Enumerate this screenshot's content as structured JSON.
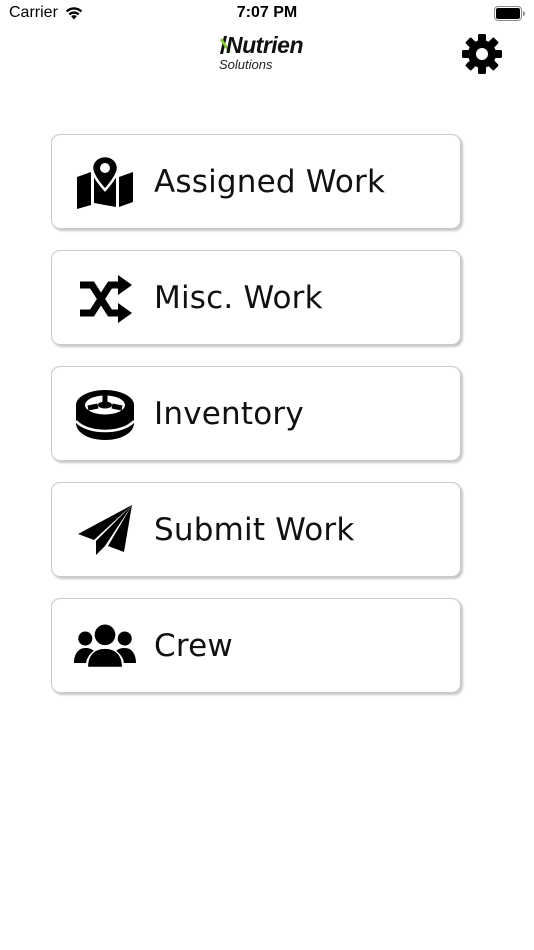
{
  "status_bar": {
    "carrier": "Carrier",
    "time": "7:07 PM",
    "wifi_icon": "wifi-icon",
    "battery_icon": "battery-icon"
  },
  "header": {
    "logo_word": "Nutrien",
    "logo_sub": "Solutions",
    "logo_accent_color": "#8dc63f",
    "settings_icon": "gear-icon"
  },
  "menu": {
    "items": [
      {
        "label": "Assigned Work",
        "icon": "map-marker-icon"
      },
      {
        "label": "Misc. Work",
        "icon": "shuffle-icon"
      },
      {
        "label": "Inventory",
        "icon": "tire-icon"
      },
      {
        "label": "Submit Work",
        "icon": "paper-plane-icon"
      },
      {
        "label": "Crew",
        "icon": "users-icon"
      }
    ]
  }
}
